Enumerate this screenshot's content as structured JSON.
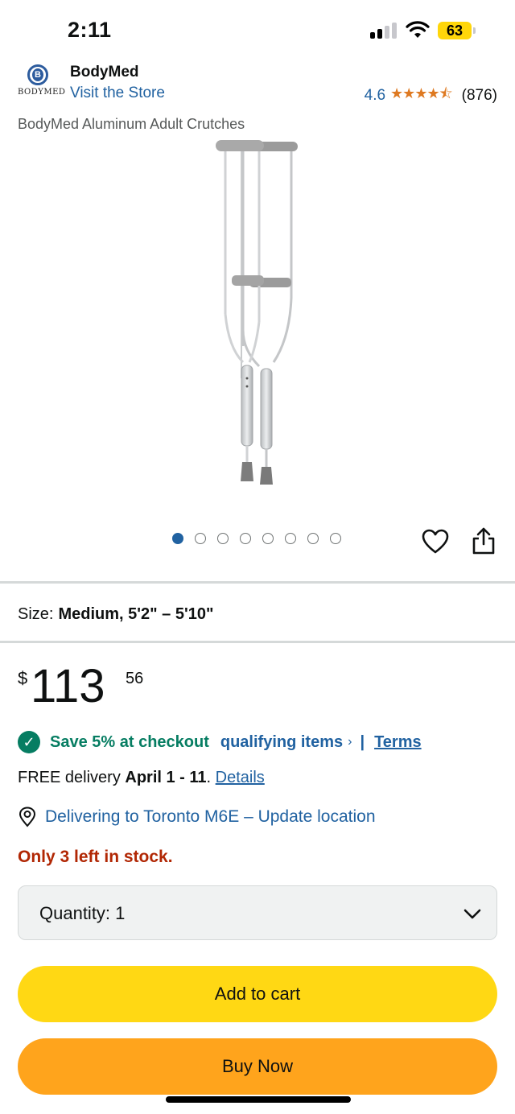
{
  "status_bar": {
    "time": "2:11",
    "battery": "63",
    "icons": [
      "cellular-signal-icon",
      "wifi-icon",
      "battery-icon"
    ]
  },
  "store": {
    "logo_text": "BODYMED",
    "logo_letter": "B",
    "name": "BodyMed",
    "visit_link": "Visit the Store",
    "rating": "4.6",
    "stars": "★★★★⯪",
    "rating_count": "(876)"
  },
  "product": {
    "title": "BodyMed Aluminum Adult Crutches",
    "image_alt": "aluminum crutches",
    "carousel": {
      "total": 8,
      "active_index": 0
    }
  },
  "size": {
    "label": "Size:",
    "value": "Medium, 5'2\" – 5'10\""
  },
  "price": {
    "currency": "$",
    "whole": "113",
    "fraction": "56"
  },
  "promo": {
    "save_text": "Save 5% at checkout",
    "qualifying_text": "qualifying items",
    "chevron": "›",
    "separator": "|",
    "terms_text": "Terms"
  },
  "delivery": {
    "prefix": "FREE delivery ",
    "date": "April 1 - 11",
    "suffix": ". ",
    "details_link": "Details"
  },
  "location": {
    "text": "Delivering to Toronto M6E – Update location"
  },
  "stock": {
    "text": "Only 3 left in stock."
  },
  "quantity": {
    "label": "Quantity:",
    "value": "1"
  },
  "buttons": {
    "add_to_cart": "Add to cart",
    "buy_now": "Buy Now"
  },
  "colors": {
    "link": "#2162a1",
    "success": "#067d62",
    "stock_warning": "#b12704",
    "add_to_cart": "#ffd814",
    "buy_now": "#ffa41c",
    "star": "#de7921"
  }
}
